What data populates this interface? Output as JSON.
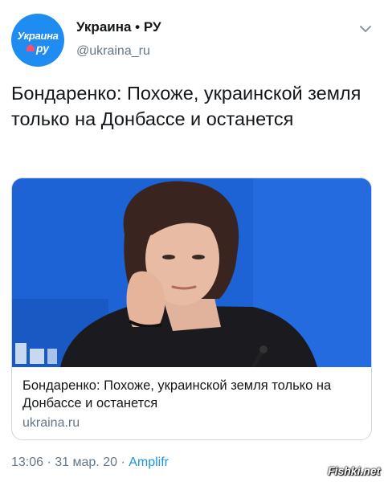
{
  "account": {
    "display_name": "Украина • РУ",
    "handle": "@ukraina_ru",
    "avatar_logo_top": "Украина",
    "avatar_logo_bottom": "ру"
  },
  "tweet": {
    "text": "Бондаренко: Похоже, украинской земля только на Донбассе и останется"
  },
  "card": {
    "title": "Бондаренко: Похоже, украинской земля только на Донбассе и останется",
    "domain": "ukraina.ru"
  },
  "meta": {
    "time": "13:06",
    "date": "31 мар. 20",
    "separator": " · ",
    "app": "Amplifr"
  },
  "watermark": "Fishki.net",
  "icons": {
    "menu": "chevron-down-icon",
    "avatar": "ukraina-ru-logo"
  },
  "colors": {
    "avatar_bg": "#1e8cf0",
    "link": "#1b95e0",
    "secondary_text": "#657786",
    "card_border": "#ccd6dd"
  }
}
